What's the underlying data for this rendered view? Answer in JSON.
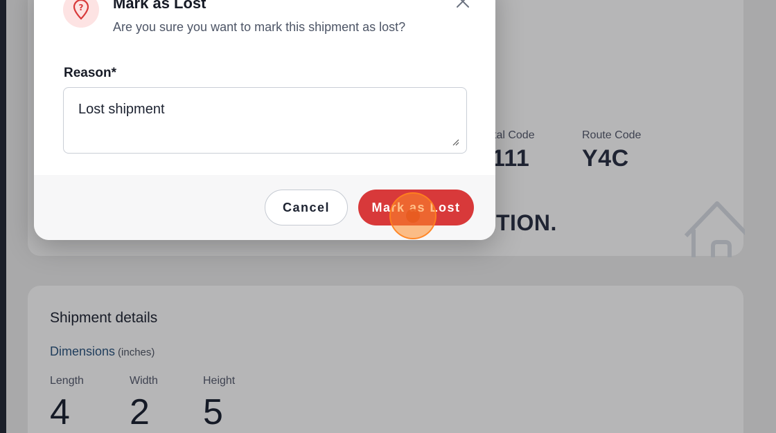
{
  "modal": {
    "title": "Mark as Lost",
    "subtitle": "Are you sure you want to mark this shipment as lost?",
    "reason_label": "Reason*",
    "reason_value": "Lost shipment",
    "cancel_label": "Cancel",
    "confirm_label": "Mark as Lost"
  },
  "background": {
    "postal_code_label": "tal Code",
    "postal_code_value": ")111",
    "route_code_label": "Route Code",
    "route_code_value": "Y4C",
    "location_text": "TION.",
    "shipment_details_title": "Shipment details",
    "dimensions_label": "Dimensions",
    "dimensions_unit": "(inches)",
    "length_label": "Length",
    "length_value": "4",
    "width_label": "Width",
    "width_value": "2",
    "height_label": "Height",
    "height_value": "5"
  },
  "colors": {
    "danger": "#d8393a",
    "overlay": "#a9a9aa"
  }
}
